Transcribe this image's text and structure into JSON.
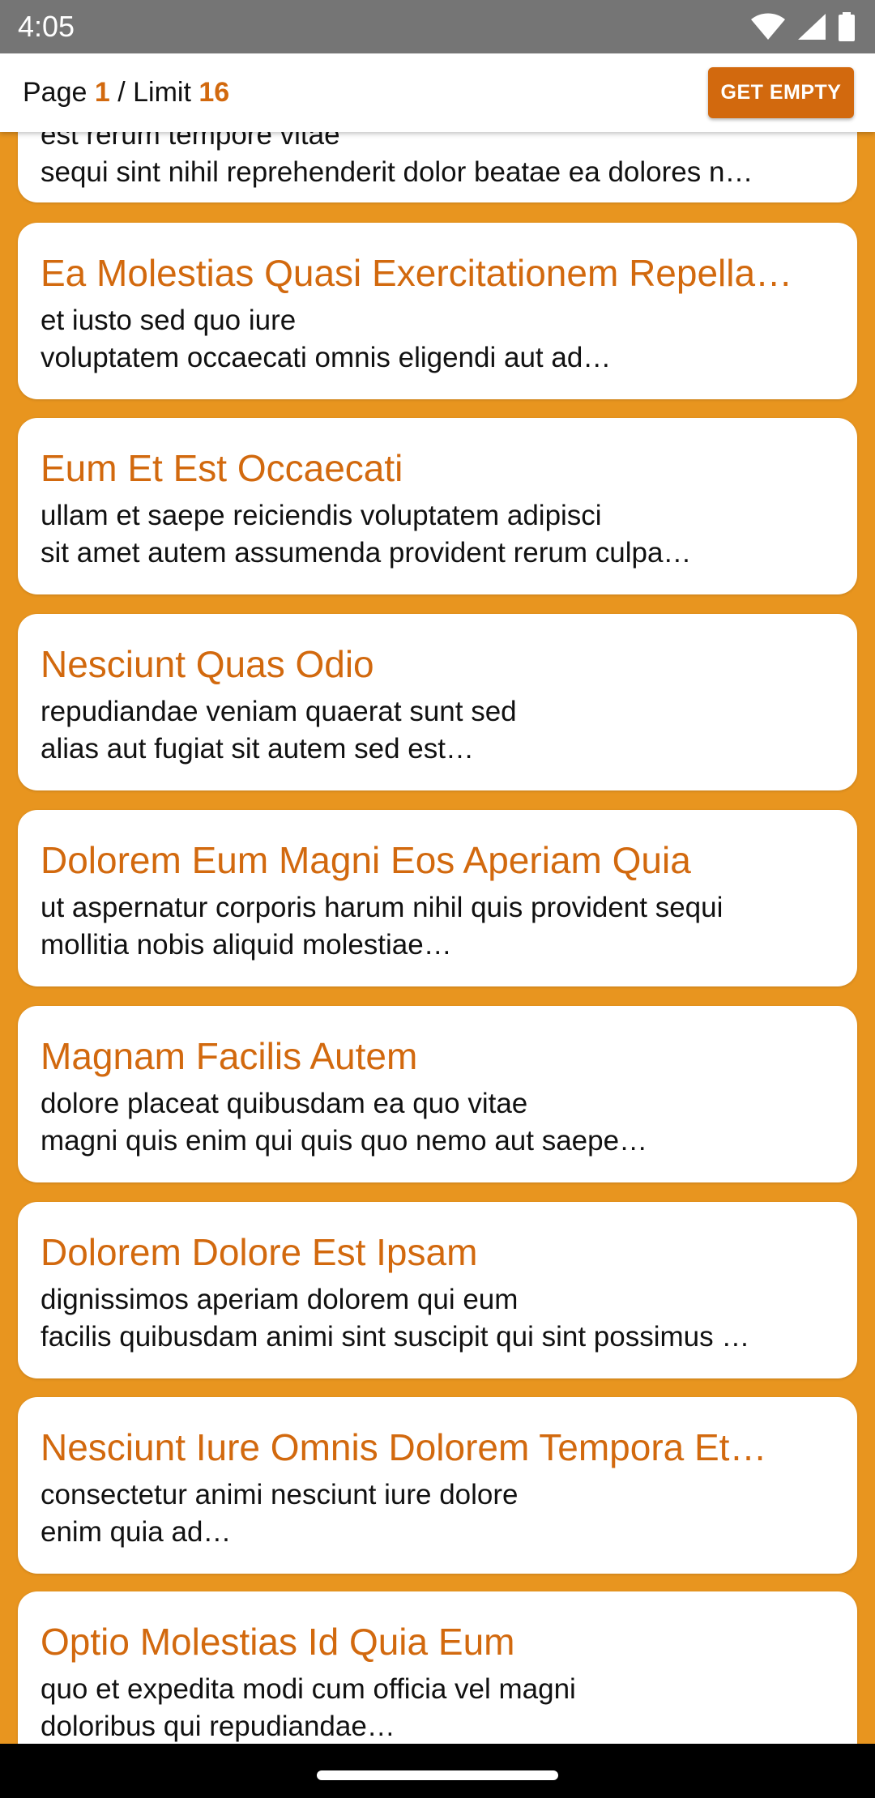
{
  "status_bar": {
    "time": "4:05",
    "icons": [
      "wifi-icon",
      "cell-signal-icon",
      "battery-icon"
    ]
  },
  "header": {
    "page_label": "Page",
    "page_number": "1",
    "separator": "/",
    "limit_label": "Limit",
    "limit_number": "16",
    "button_label": "GET EMPTY"
  },
  "colors": {
    "background": "#E8951F",
    "accent": "#D2690E",
    "card": "#ffffff",
    "status_bar": "#757575"
  },
  "items": [
    {
      "title": "",
      "line1": "est rerum tempore vitae",
      "line2": "sequi sint nihil reprehenderit dolor beatae ea dolores n…"
    },
    {
      "title": "Ea Molestias Quasi Exercitationem Repella…",
      "line1": "et iusto sed quo iure",
      "line2": "voluptatem occaecati omnis eligendi aut ad…"
    },
    {
      "title": "Eum Et Est Occaecati",
      "line1": "ullam et saepe reiciendis voluptatem adipisci",
      "line2": "sit amet autem assumenda provident rerum culpa…"
    },
    {
      "title": "Nesciunt Quas Odio",
      "line1": "repudiandae veniam quaerat sunt sed",
      "line2": "alias aut fugiat sit autem sed est…"
    },
    {
      "title": "Dolorem Eum Magni Eos Aperiam Quia",
      "line1": "ut aspernatur corporis harum nihil quis provident sequi",
      "line2": "mollitia nobis aliquid molestiae…"
    },
    {
      "title": "Magnam Facilis Autem",
      "line1": "dolore placeat quibusdam ea quo vitae",
      "line2": "magni quis enim qui quis quo nemo aut saepe…"
    },
    {
      "title": "Dolorem Dolore Est Ipsam",
      "line1": "dignissimos aperiam dolorem qui eum",
      "line2": "facilis quibusdam animi sint suscipit qui sint possimus …"
    },
    {
      "title": "Nesciunt Iure Omnis Dolorem Tempora Et…",
      "line1": "consectetur animi nesciunt iure dolore",
      "line2": "enim quia ad…"
    },
    {
      "title": "Optio Molestias Id Quia Eum",
      "line1": "quo et expedita modi cum officia vel magni",
      "line2": "doloribus qui repudiandae…"
    }
  ]
}
